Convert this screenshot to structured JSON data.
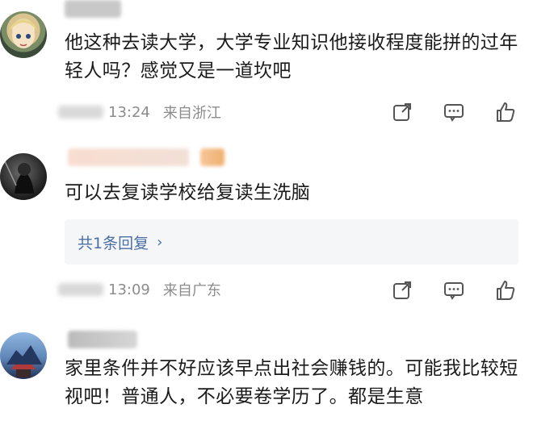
{
  "comments": [
    {
      "text": "他这种去读大学，大学专业知识他接收程度能拼的过年轻人吗？感觉又是一道坎吧",
      "time": "13:24",
      "location": "来自浙江"
    },
    {
      "text": "可以去复读学校给复读生洗脑",
      "time": "13:09",
      "location": "来自广东",
      "replies_label": "共1条回复"
    },
    {
      "text": "家里条件并不好应该早点出社会赚钱的。可能我比较短视吧！普通人，不必要卷学历了。都是生意"
    }
  ],
  "icons": {
    "share": "share-icon",
    "comment": "comment-icon",
    "like": "like-icon"
  },
  "colors": {
    "text": "#1b1b1b",
    "meta": "#8c8c8c",
    "link": "#4a6fa5",
    "reply_bg": "#f5f6f8"
  }
}
